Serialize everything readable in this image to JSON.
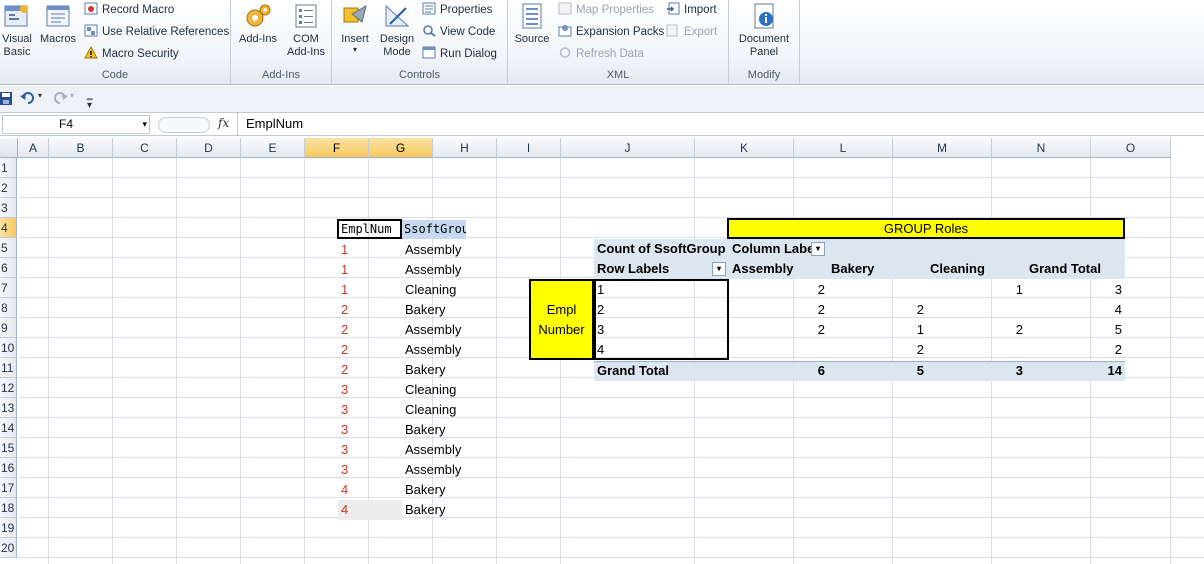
{
  "ribbon": {
    "code": {
      "label": "Code",
      "visual_basic": "Visual\nBasic",
      "macros": "Macros",
      "record_macro": "Record Macro",
      "use_relative": "Use Relative References",
      "macro_security": "Macro Security"
    },
    "addins": {
      "label": "Add-Ins",
      "add_ins": "Add-Ins",
      "com_add_ins": "COM\nAdd-Ins"
    },
    "controls": {
      "label": "Controls",
      "insert": "Insert",
      "design_mode": "Design\nMode",
      "properties": "Properties",
      "view_code": "View Code",
      "run_dialog": "Run Dialog"
    },
    "xml": {
      "label": "XML",
      "source": "Source",
      "map_properties": "Map Properties",
      "expansion_packs": "Expansion Packs",
      "refresh_data": "Refresh Data",
      "import": "Import",
      "export": "Export"
    },
    "modify": {
      "label": "Modify",
      "document_panel": "Document\nPanel"
    }
  },
  "formula_bar": {
    "name_box": "F4",
    "fx": "fx",
    "content": "EmplNum"
  },
  "grid": {
    "columns": [
      "A",
      "B",
      "C",
      "D",
      "E",
      "F",
      "G",
      "H",
      "I",
      "J",
      "K",
      "L",
      "M",
      "N",
      "O"
    ],
    "rows": [
      "1",
      "2",
      "3",
      "4",
      "5",
      "6",
      "7",
      "8",
      "9",
      "10",
      "11",
      "12",
      "13",
      "14",
      "15",
      "16",
      "17",
      "18",
      "19",
      "20"
    ]
  },
  "source_table": {
    "headers": [
      "EmplNum",
      "SsoftGroup"
    ],
    "rows": [
      [
        "1",
        "Assembly"
      ],
      [
        "1",
        "Assembly"
      ],
      [
        "1",
        "Cleaning"
      ],
      [
        "2",
        "Bakery"
      ],
      [
        "2",
        "Assembly"
      ],
      [
        "2",
        "Assembly"
      ],
      [
        "2",
        "Bakery"
      ],
      [
        "3",
        "Cleaning"
      ],
      [
        "3",
        "Cleaning"
      ],
      [
        "3",
        "Bakery"
      ],
      [
        "3",
        "Assembly"
      ],
      [
        "3",
        "Assembly"
      ],
      [
        "4",
        "Bakery"
      ],
      [
        "4",
        "Bakery"
      ]
    ]
  },
  "pivot": {
    "group_roles": "GROUP Roles",
    "empl_number": "Empl\nNumber",
    "count_label": "Count of SsoftGroup",
    "column_labels": "Column Labe",
    "row_labels": "Row Labels",
    "col_headers": [
      "Assembly",
      "Bakery",
      "Cleaning",
      "Grand Total"
    ],
    "rows": [
      {
        "label": "1",
        "values": [
          "2",
          "",
          "1",
          "3"
        ]
      },
      {
        "label": "2",
        "values": [
          "2",
          "2",
          "",
          "4"
        ]
      },
      {
        "label": "3",
        "values": [
          "2",
          "1",
          "2",
          "5"
        ]
      },
      {
        "label": "4",
        "values": [
          "",
          "2",
          "",
          "2"
        ]
      }
    ],
    "grand_total": {
      "label": "Grand Total",
      "values": [
        "6",
        "5",
        "3",
        "14"
      ]
    }
  },
  "colors": {
    "yellow": "#ffff00",
    "pivot_header": "#dce6f1",
    "red_number": "#c0392b"
  }
}
